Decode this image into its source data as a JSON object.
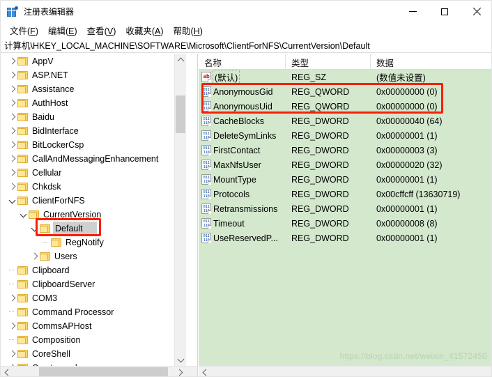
{
  "window": {
    "title": "注册表编辑器",
    "icon": "registry-editor-icon",
    "minimize_label": "最小化",
    "maximize_label": "最大化",
    "close_label": "关闭"
  },
  "menubar": {
    "items": [
      {
        "label": "文件(F)",
        "text": "文件(",
        "mnemonic": "F",
        "tail": ")"
      },
      {
        "label": "编辑(E)",
        "text": "编辑(",
        "mnemonic": "E",
        "tail": ")"
      },
      {
        "label": "查看(V)",
        "text": "查看(",
        "mnemonic": "V",
        "tail": ")"
      },
      {
        "label": "收藏夹(A)",
        "text": "收藏夹(",
        "mnemonic": "A",
        "tail": ")"
      },
      {
        "label": "帮助(H)",
        "text": "帮助(",
        "mnemonic": "H",
        "tail": ")"
      }
    ]
  },
  "address": {
    "path": "计算机\\HKEY_LOCAL_MACHINE\\SOFTWARE\\Microsoft\\ClientForNFS\\CurrentVersion\\Default"
  },
  "tree": {
    "items": [
      {
        "label": "AppV",
        "depth": 1,
        "state": "collapsed"
      },
      {
        "label": "ASP.NET",
        "depth": 1,
        "state": "collapsed"
      },
      {
        "label": "Assistance",
        "depth": 1,
        "state": "collapsed"
      },
      {
        "label": "AuthHost",
        "depth": 1,
        "state": "collapsed"
      },
      {
        "label": "Baidu",
        "depth": 1,
        "state": "collapsed"
      },
      {
        "label": "BidInterface",
        "depth": 1,
        "state": "collapsed"
      },
      {
        "label": "BitLockerCsp",
        "depth": 1,
        "state": "collapsed"
      },
      {
        "label": "CallAndMessagingEnhancement",
        "depth": 1,
        "state": "collapsed"
      },
      {
        "label": "Cellular",
        "depth": 1,
        "state": "collapsed"
      },
      {
        "label": "Chkdsk",
        "depth": 1,
        "state": "collapsed"
      },
      {
        "label": "ClientForNFS",
        "depth": 1,
        "state": "expanded"
      },
      {
        "label": "CurrentVersion",
        "depth": 2,
        "state": "expanded"
      },
      {
        "label": "Default",
        "depth": 3,
        "state": "expanded",
        "selected": true
      },
      {
        "label": "RegNotify",
        "depth": 4,
        "state": "leaf"
      },
      {
        "label": "Users",
        "depth": 3,
        "state": "collapsed"
      },
      {
        "label": "Clipboard",
        "depth": 1,
        "state": "leaf"
      },
      {
        "label": "ClipboardServer",
        "depth": 1,
        "state": "leaf"
      },
      {
        "label": "COM3",
        "depth": 1,
        "state": "collapsed"
      },
      {
        "label": "Command Processor",
        "depth": 1,
        "state": "leaf"
      },
      {
        "label": "CommsAPHost",
        "depth": 1,
        "state": "collapsed"
      },
      {
        "label": "Composition",
        "depth": 1,
        "state": "leaf"
      },
      {
        "label": "CoreShell",
        "depth": 1,
        "state": "collapsed"
      },
      {
        "label": "Cryptography",
        "depth": 1,
        "state": "collapsed"
      }
    ]
  },
  "values": {
    "columns": [
      "名称",
      "类型",
      "数据"
    ],
    "rows": [
      {
        "name": "(默认)",
        "type": "REG_SZ",
        "data": "(数值未设置)",
        "icon": "string-value-icon"
      },
      {
        "name": "AnonymousGid",
        "type": "REG_QWORD",
        "data": "0x00000000 (0)",
        "icon": "binary-value-icon"
      },
      {
        "name": "AnonymousUid",
        "type": "REG_QWORD",
        "data": "0x00000000 (0)",
        "icon": "binary-value-icon"
      },
      {
        "name": "CacheBlocks",
        "type": "REG_DWORD",
        "data": "0x00000040 (64)",
        "icon": "binary-value-icon"
      },
      {
        "name": "DeleteSymLinks",
        "type": "REG_DWORD",
        "data": "0x00000001 (1)",
        "icon": "binary-value-icon"
      },
      {
        "name": "FirstContact",
        "type": "REG_DWORD",
        "data": "0x00000003 (3)",
        "icon": "binary-value-icon"
      },
      {
        "name": "MaxNfsUser",
        "type": "REG_DWORD",
        "data": "0x00000020 (32)",
        "icon": "binary-value-icon"
      },
      {
        "name": "MountType",
        "type": "REG_DWORD",
        "data": "0x00000001 (1)",
        "icon": "binary-value-icon"
      },
      {
        "name": "Protocols",
        "type": "REG_DWORD",
        "data": "0x00cffcff (13630719)",
        "icon": "binary-value-icon"
      },
      {
        "name": "Retransmissions",
        "type": "REG_DWORD",
        "data": "0x00000001 (1)",
        "icon": "binary-value-icon"
      },
      {
        "name": "Timeout",
        "type": "REG_DWORD",
        "data": "0x00000008 (8)",
        "icon": "binary-value-icon"
      },
      {
        "name": "UseReservedP...",
        "type": "REG_DWORD",
        "data": "0x00000001 (1)",
        "icon": "binary-value-icon"
      }
    ]
  },
  "annotations": {
    "highlight_color": "#f91e06",
    "boxes": [
      {
        "name": "anonymous-gid-uid-highlight",
        "target": "AnonymousGid / AnonymousUid rows"
      },
      {
        "name": "default-key-highlight",
        "target": "Default tree node"
      }
    ]
  },
  "watermark": {
    "text": "https://blog.csdn.net/weixin_41572450"
  },
  "icons": {
    "string_icon_text": "ab",
    "binary_icon_line1": "011",
    "binary_icon_line2": "110"
  }
}
